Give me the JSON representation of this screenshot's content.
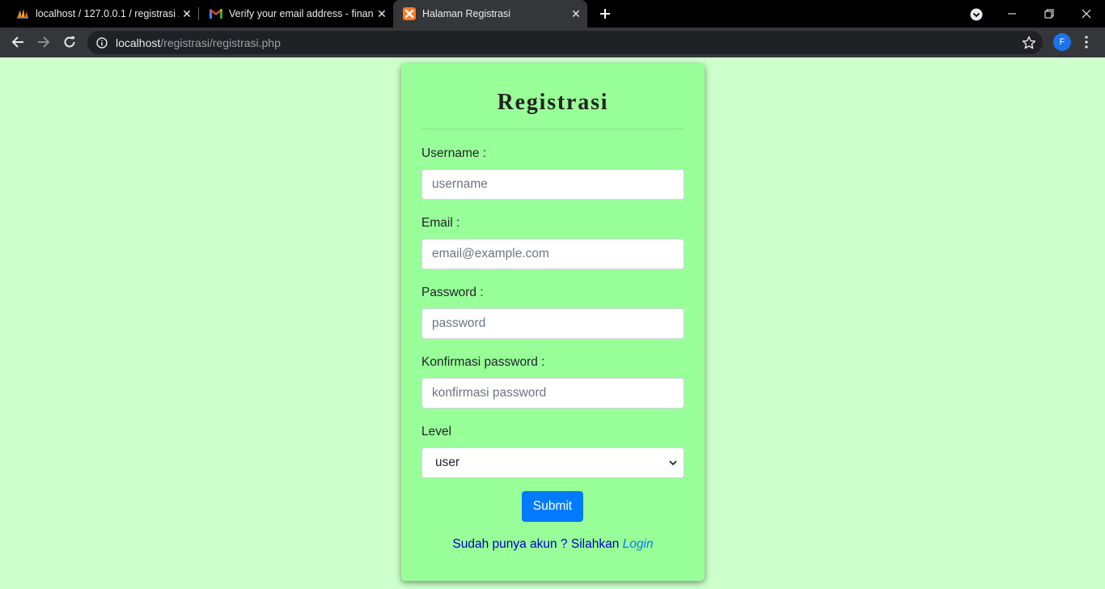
{
  "browser": {
    "tabs": [
      {
        "title": "localhost / 127.0.0.1 / registrasi / ",
        "icon": "phpmyadmin-icon"
      },
      {
        "title": "Verify your email address - finan",
        "icon": "gmail-icon"
      },
      {
        "title": "Halaman Registrasi",
        "icon": "xampp-icon",
        "active": true
      }
    ],
    "url_host": "localhost",
    "url_path": "/registrasi/registrasi.php",
    "profile_initial": "F",
    "profile_color": "#1a73e8"
  },
  "form": {
    "title": "Registrasi",
    "username_label": "Username :",
    "username_placeholder": "username",
    "email_label": "Email :",
    "email_placeholder": "email@example.com",
    "password_label": "Password :",
    "password_placeholder": "password",
    "confirm_label": "Konfirmasi password :",
    "confirm_placeholder": "konfirmasi password",
    "level_label": "Level",
    "level_value": "user",
    "submit_label": "Submit",
    "login_prompt": "Sudah punya akun ? Silahkan",
    "login_link": "Login"
  },
  "colors": {
    "page_bg": "#ccffcc",
    "card_bg": "#99ff99",
    "button": "#007bff"
  }
}
